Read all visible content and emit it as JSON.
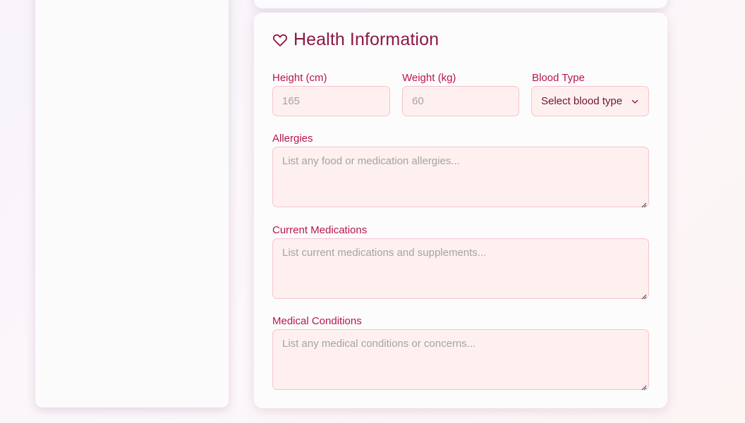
{
  "section": {
    "title": "Health Information",
    "icon": "heart-icon"
  },
  "fields": {
    "height": {
      "label": "Height (cm)",
      "placeholder": "165"
    },
    "weight": {
      "label": "Weight (kg)",
      "placeholder": "60"
    },
    "blood_type": {
      "label": "Blood Type",
      "value": "Select blood type"
    },
    "allergies": {
      "label": "Allergies",
      "placeholder": "List any food or medication allergies..."
    },
    "medications": {
      "label": "Current Medications",
      "placeholder": "List current medications and supplements..."
    },
    "conditions": {
      "label": "Medical Conditions",
      "placeholder": "List any medical conditions or concerns..."
    }
  },
  "colors": {
    "accent": "#b8154f",
    "title": "#8c1845",
    "field_bg": "#fff0f0",
    "field_border": "#f4c4cd"
  }
}
